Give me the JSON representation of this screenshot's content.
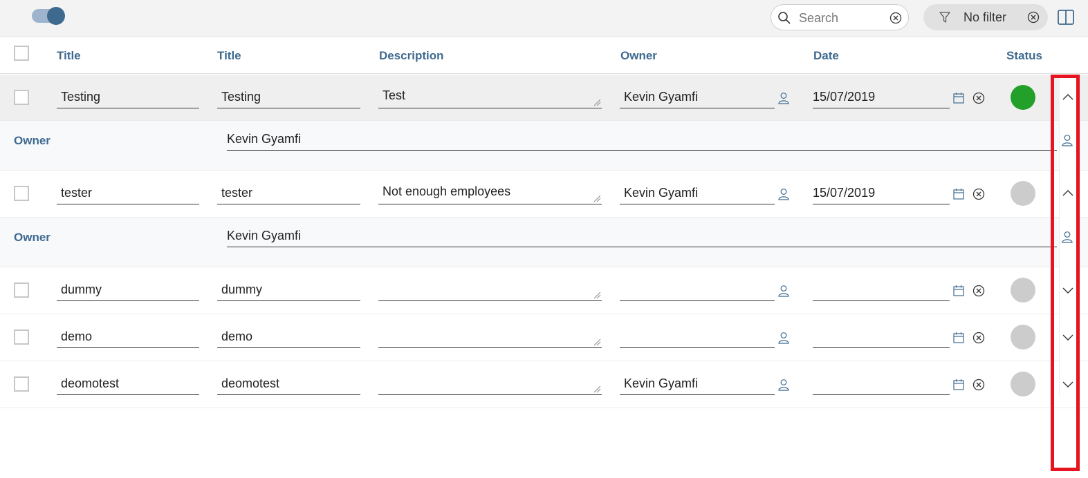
{
  "toolbar": {
    "search": {
      "placeholder": "Search"
    },
    "filter": {
      "label": "No filter"
    }
  },
  "columns": [
    "Title",
    "Title",
    "Description",
    "Owner",
    "Date",
    "Status"
  ],
  "rows": [
    {
      "title": "Testing",
      "title2": "Testing",
      "description": "Test",
      "owner": "Kevin Gyamfi",
      "date": "15/07/2019",
      "status_color": "#22a02a",
      "expanded": true
    },
    {
      "title": "tester",
      "title2": "tester",
      "description": "Not enough employees",
      "owner": "Kevin Gyamfi",
      "date": "15/07/2019",
      "status_color": "#cccccc",
      "expanded": true
    },
    {
      "title": "dummy",
      "title2": "dummy",
      "description": "",
      "owner": "",
      "date": "",
      "status_color": "#cccccc",
      "expanded": false
    },
    {
      "title": "demo",
      "title2": "demo",
      "description": "",
      "owner": "",
      "date": "",
      "status_color": "#cccccc",
      "expanded": false
    },
    {
      "title": "deomotest",
      "title2": "deomotest",
      "description": "",
      "owner": "Kevin Gyamfi",
      "date": "",
      "status_color": "#cccccc",
      "expanded": false
    }
  ],
  "details": [
    {
      "label": "Owner",
      "value": "Kevin Gyamfi"
    },
    {
      "label": "Owner",
      "value": "Kevin Gyamfi"
    }
  ],
  "colors": {
    "accent": "#3f6a90",
    "highlight": "#e5141f"
  }
}
